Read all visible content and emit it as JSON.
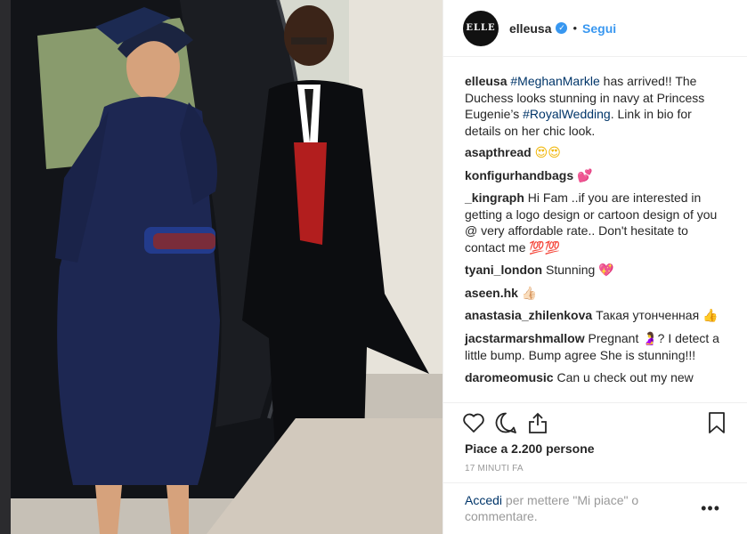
{
  "post": {
    "avatar_text": "ELLE",
    "username": "elleusa",
    "follow_label": "Segui",
    "separator": "•"
  },
  "caption": {
    "user": "elleusa",
    "tag1": "#MeghanMarkle",
    "text1": " has arrived!! The Duchess looks stunning in navy at Princess Eugenie’s ",
    "tag2": "#RoyalWedding",
    "text2": ". Link in bio for details on her chic look."
  },
  "comments": [
    {
      "user": "asapthread",
      "text": "",
      "emoji": "😍😍"
    },
    {
      "user": "konfigurhandbags",
      "text": "",
      "emoji": "💕"
    },
    {
      "user": "_kingraph",
      "text": "Hi Fam ..if you are interested in getting a logo design or cartoon design of you @ very affordable rate.. Don't hesitate to contact me ",
      "emoji": "💯💯"
    },
    {
      "user": "tyani_london",
      "text": "Stunning ",
      "emoji": "💖"
    },
    {
      "user": "aseen.hk",
      "text": "",
      "emoji": "👍🏻"
    },
    {
      "user": "anastasia_zhilenkova",
      "text": "Такая утонченная ",
      "emoji": "👍"
    },
    {
      "user": "jacstarmarshmallow",
      "text": "Pregnant ",
      "emoji2": "🤰",
      "text2": "? I detect a little bump. Bump agree She is stunning!!!"
    },
    {
      "user": "daromeomusic",
      "text": "Can u check out my new"
    }
  ],
  "likes_label": "Piace a 2.200 persone",
  "time_label": "17 MINUTI FA",
  "footer": {
    "login_label": "Accedi",
    "rest": " per mettere \"Mi piace\" o commentare.",
    "more_label": "•••"
  },
  "icons": {
    "like": "heart-icon",
    "comment": "comment-bubble-icon",
    "share": "share-icon",
    "save": "bookmark-icon"
  }
}
